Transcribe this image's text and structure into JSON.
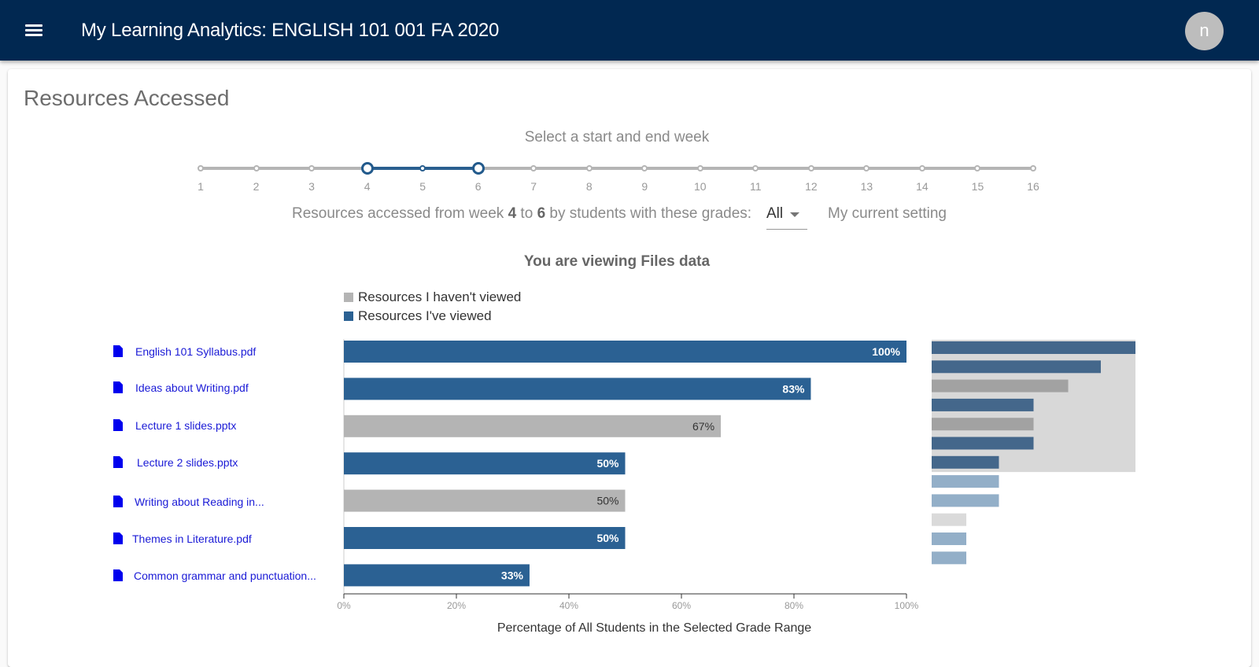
{
  "header": {
    "menu_icon": "hamburger-menu-icon",
    "title": "My Learning Analytics: ENGLISH 101 001 FA 2020",
    "avatar_initial": "n"
  },
  "page": {
    "title": "Resources Accessed"
  },
  "week_slider": {
    "caption": "Select a start and end week",
    "weeks": [
      "1",
      "2",
      "3",
      "4",
      "5",
      "6",
      "7",
      "8",
      "9",
      "10",
      "11",
      "12",
      "13",
      "14",
      "15",
      "16"
    ],
    "start_week": 4,
    "end_week": 6,
    "track_color": "#b5b5b5",
    "active_color": "#225a8c"
  },
  "filter": {
    "prefix": "Resources accessed from week",
    "start": "4",
    "to": "to",
    "end": "6",
    "suffix": "by students with these grades:",
    "grade_selected": "All",
    "setting_label": "My current setting"
  },
  "view_title": "You are viewing Files data",
  "legend": [
    {
      "label": "Resources I haven't viewed",
      "color": "#b4b4b4"
    },
    {
      "label": "Resources I've viewed",
      "color": "#2b6193"
    }
  ],
  "files": [
    {
      "name": "English 101 Syllabus.pdf",
      "icon": "file-icon"
    },
    {
      "name": "Ideas about Writing.pdf",
      "icon": "file-icon"
    },
    {
      "name": "Lecture 1 slides.pptx",
      "icon": "file-icon"
    },
    {
      "name": "Lecture 2 slides.pptx",
      "icon": "file-icon"
    },
    {
      "name": "Writing about Reading in...",
      "icon": "file-icon"
    },
    {
      "name": "Themes in Literature.pdf",
      "icon": "file-icon"
    },
    {
      "name": "Common grammar and punctuation...",
      "icon": "file-icon"
    }
  ],
  "colors": {
    "header_bg": "#012851",
    "viewed": "#2b6193",
    "not_viewed": "#b4b4b4",
    "mini_viewed_in_window": "#44678b",
    "mini_not_viewed_in_window": "#a2a2a2",
    "mini_viewed_outside": "#93afc8",
    "mini_not_viewed_outside": "#dadada",
    "mini_window_bg": "#d8d8d8",
    "link": "#1a1ad6"
  },
  "chart_data": {
    "type": "bar",
    "orientation": "horizontal",
    "categories": [
      "English 101 Syllabus.pdf",
      "Ideas about Writing.pdf",
      "Lecture 1 slides.pptx",
      "Lecture 2 slides.pptx",
      "Writing about Reading in...",
      "Themes in Literature.pdf",
      "Common grammar and punctuation..."
    ],
    "values": [
      100,
      83,
      67,
      50,
      50,
      50,
      33
    ],
    "value_labels": [
      "100%",
      "83%",
      "67%",
      "50%",
      "50%",
      "50%",
      "33%"
    ],
    "viewed": [
      true,
      true,
      false,
      true,
      false,
      true,
      true
    ],
    "xlabel": "Percentage of All Students in the Selected Grade Range",
    "ylabel": "",
    "xlim": [
      0,
      100
    ],
    "xticks": [
      "0%",
      "20%",
      "40%",
      "60%",
      "80%",
      "100%"
    ],
    "xtick_values": [
      0,
      20,
      40,
      60,
      80,
      100
    ],
    "grid": false,
    "legend_position": "top-left",
    "minimap": {
      "values": [
        100,
        83,
        67,
        50,
        50,
        50,
        33,
        33,
        33,
        17,
        17,
        17
      ],
      "viewed": [
        true,
        true,
        false,
        true,
        false,
        true,
        true,
        true,
        true,
        false,
        true,
        true
      ],
      "window_range": [
        0,
        6
      ]
    }
  }
}
